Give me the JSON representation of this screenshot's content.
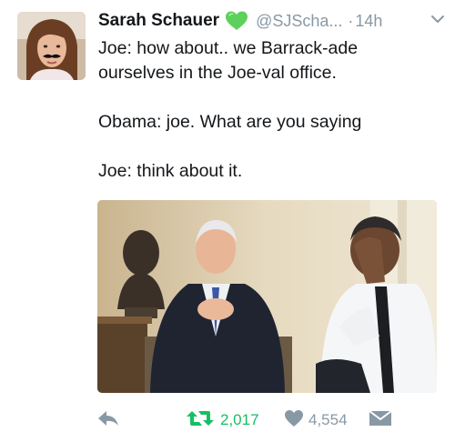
{
  "tweet": {
    "display_name": "Sarah Schauer",
    "verified_badge_icon": "green-heart-icon",
    "handle": "@SJScha...",
    "dot": "·",
    "time": "14h",
    "lines": [
      "Joe: how about.. we Barrack-ade",
      "ourselves in the Joe-val office.",
      "Obama: joe. What are you saying",
      "Joe: think about it."
    ],
    "media_description_icon": "photo",
    "actions": {
      "reply_icon": "reply-icon",
      "retweet_icon": "retweet-icon",
      "retweet_count": "2,017",
      "like_icon": "heart-icon",
      "like_count": "4,554",
      "dm_icon": "envelope-icon"
    }
  },
  "colors": {
    "text": "#14171a",
    "secondary": "#8899a6",
    "retweet_active": "#17bf63",
    "heart_emoji": "#5ed15c"
  }
}
